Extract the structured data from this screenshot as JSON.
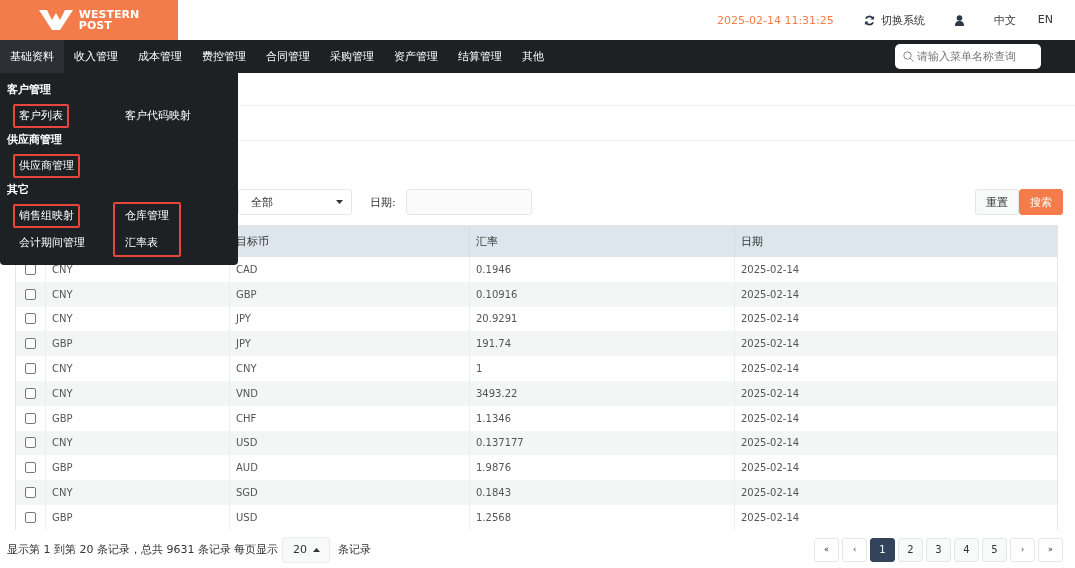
{
  "header": {
    "logo_text": [
      "WESTERN",
      "POST"
    ],
    "datetime": "2025-02-14 11:31:25",
    "switch_system": "切换系统",
    "languages": [
      {
        "label": "中文",
        "selected": false
      },
      {
        "label": "EN",
        "selected": false
      }
    ]
  },
  "nav": {
    "items": [
      {
        "label": "基础资料",
        "selected": true
      },
      {
        "label": "收入管理",
        "selected": false
      },
      {
        "label": "成本管理",
        "selected": false
      },
      {
        "label": "费控管理",
        "selected": false
      },
      {
        "label": "合同管理",
        "selected": false
      },
      {
        "label": "采购管理",
        "selected": false
      },
      {
        "label": "资产管理",
        "selected": false
      },
      {
        "label": "结算管理",
        "selected": false
      },
      {
        "label": "其他",
        "selected": false
      }
    ],
    "search": {
      "placeholder": "请输入菜单名称查询"
    }
  },
  "menu": {
    "sections": [
      {
        "title": "客户管理",
        "columns": [
          {
            "highlighted": false,
            "items": [
              {
                "label": "客户列表",
                "highlighted": true
              }
            ]
          },
          {
            "highlighted": false,
            "items": [
              {
                "label": "客户代码映射",
                "highlighted": false
              }
            ]
          }
        ]
      },
      {
        "title": "供应商管理",
        "columns": [
          {
            "highlighted": false,
            "items": [
              {
                "label": "供应商管理",
                "highlighted": true
              }
            ]
          }
        ]
      },
      {
        "title": "其它",
        "columns": [
          {
            "highlighted": false,
            "items": [
              {
                "label": "销售组映射",
                "highlighted": true
              },
              {
                "label": "会计期间管理",
                "highlighted": false
              }
            ]
          },
          {
            "highlighted": true,
            "items": [
              {
                "label": "仓库管理",
                "highlighted": false
              },
              {
                "label": "汇率表",
                "highlighted": false
              }
            ]
          }
        ]
      }
    ]
  },
  "filters": {
    "select_value": "全部",
    "date_label": "日期:",
    "buttons": [
      {
        "label": "重置",
        "kind": "default"
      },
      {
        "label": "搜索",
        "kind": "primary"
      }
    ]
  },
  "table": {
    "columns": [
      "",
      "目标币",
      "汇率",
      "日期"
    ],
    "rows": [
      {
        "checked": false,
        "cells": [
          "CNY",
          "CAD",
          "0.1946",
          "2025-02-14"
        ]
      },
      {
        "checked": false,
        "cells": [
          "CNY",
          "GBP",
          "0.10916",
          "2025-02-14"
        ]
      },
      {
        "checked": false,
        "cells": [
          "CNY",
          "JPY",
          "20.9291",
          "2025-02-14"
        ]
      },
      {
        "checked": false,
        "cells": [
          "GBP",
          "JPY",
          "191.74",
          "2025-02-14"
        ]
      },
      {
        "checked": false,
        "cells": [
          "CNY",
          "CNY",
          "1",
          "2025-02-14"
        ]
      },
      {
        "checked": false,
        "cells": [
          "CNY",
          "VND",
          "3493.22",
          "2025-02-14"
        ]
      },
      {
        "checked": false,
        "cells": [
          "GBP",
          "CHF",
          "1.1346",
          "2025-02-14"
        ]
      },
      {
        "checked": false,
        "cells": [
          "CNY",
          "USD",
          "0.137177",
          "2025-02-14"
        ]
      },
      {
        "checked": false,
        "cells": [
          "GBP",
          "AUD",
          "1.9876",
          "2025-02-14"
        ]
      },
      {
        "checked": false,
        "cells": [
          "CNY",
          "SGD",
          "0.1843",
          "2025-02-14"
        ]
      },
      {
        "checked": false,
        "cells": [
          "GBP",
          "USD",
          "1.2568",
          "2025-02-14"
        ]
      }
    ]
  },
  "footer": {
    "summary": "显示第 1 到第 20 条记录，总共 9631 条记录 每页显示",
    "page_size": "20",
    "suffix": "条记录",
    "pages": [
      {
        "label": "«",
        "kind": "nav",
        "selected": false
      },
      {
        "label": "‹",
        "kind": "nav",
        "selected": false
      },
      {
        "label": "1",
        "kind": "page",
        "selected": true
      },
      {
        "label": "2",
        "kind": "page",
        "selected": false
      },
      {
        "label": "3",
        "kind": "page",
        "selected": false
      },
      {
        "label": "4",
        "kind": "page",
        "selected": false
      },
      {
        "label": "5",
        "kind": "page",
        "selected": false
      },
      {
        "label": "›",
        "kind": "nav",
        "selected": false
      },
      {
        "label": "»",
        "kind": "nav",
        "selected": false
      }
    ]
  }
}
